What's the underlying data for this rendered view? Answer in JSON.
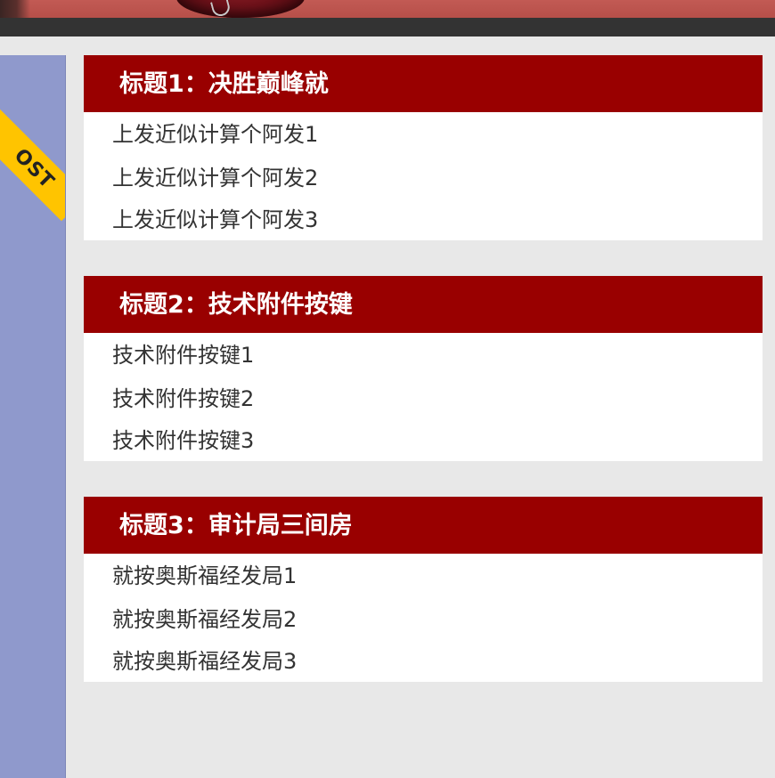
{
  "ribbon": {
    "text": "OST",
    "color": "#ffc400"
  },
  "colors": {
    "header_bg": "#990000",
    "header_text": "#ffffff",
    "page_bg": "#e8e8e8",
    "nav_bg": "#333333",
    "left_panel_bg": "#8f99cc",
    "item_text": "#333333"
  },
  "sections": [
    {
      "title": "标题1：决胜巅峰就",
      "items": [
        "上发近似计算个阿发1",
        "上发近似计算个阿发2",
        "上发近似计算个阿发3"
      ]
    },
    {
      "title": "标题2：技术附件按键",
      "items": [
        "技术附件按键1",
        "技术附件按键2",
        "技术附件按键3"
      ]
    },
    {
      "title": "标题3：审计局三间房",
      "items": [
        "就按奥斯福经发局1",
        "就按奥斯福经发局2",
        "就按奥斯福经发局3"
      ]
    }
  ]
}
